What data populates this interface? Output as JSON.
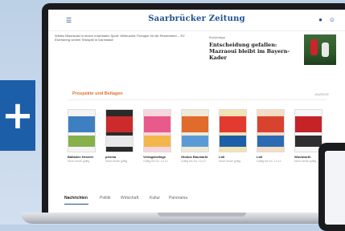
{
  "header": {
    "logo": "Saarbrücker Zeitung",
    "menu_icon": "menu-icon",
    "location_icon": "location-icon",
    "user_icon": "user-icon"
  },
  "badge": {
    "symbol": "+"
  },
  "teaser": {
    "left_text": "Wildes Mischwald in einem maximalen Sport: Wirtkurzeit-Therapie für die Reservisten – SV Elversberg verliert Testspiel in Darmstadt",
    "kicker": "Bundesliga",
    "headline": "Entscheidung gefallen: Mazraoui bleibt im Bayern-Kader"
  },
  "prospekte": {
    "title": "Prospekte und Beilagen",
    "more": "ANZEIGE",
    "items": [
      {
        "name": "Balladen Hessler",
        "sub": "Noch heute gültig",
        "colors": [
          "#f4f4f4",
          "#3e7fc1",
          "#88b04b"
        ]
      },
      {
        "name": "prisma",
        "sub": "Noch heute gültig",
        "colors": [
          "#2a2a2a",
          "#cc2b2b",
          "#e9e9e9"
        ]
      },
      {
        "name": "Verlagsbeilage",
        "sub": "Gültig bis So. 14.12.",
        "colors": [
          "#f7d6de",
          "#e85a8b",
          "#f3b64a"
        ]
      },
      {
        "name": "Globus Baumarkt",
        "sub": "Gültig bis Sa. 13.12.",
        "colors": [
          "#f0e9d8",
          "#e06b2c",
          "#5a9bd5"
        ]
      },
      {
        "name": "Lidl",
        "sub": "Noch heute gültig",
        "colors": [
          "#f2e3b5",
          "#e23a2f",
          "#1b5fa8"
        ]
      },
      {
        "name": "Lidl",
        "sub": "Gültig bis So. 14.12.",
        "colors": [
          "#f5dcc4",
          "#d8432f",
          "#2c6bb3"
        ]
      },
      {
        "name": "Woolworth",
        "sub": "Noch heute gültig",
        "colors": [
          "#f8f8f8",
          "#c62328",
          "#2f2f2f"
        ]
      }
    ]
  },
  "nav": {
    "tabs": [
      "Nachrichten",
      "Politik",
      "Wirtschaft",
      "Kultur",
      "Panorama"
    ],
    "active": 0
  }
}
